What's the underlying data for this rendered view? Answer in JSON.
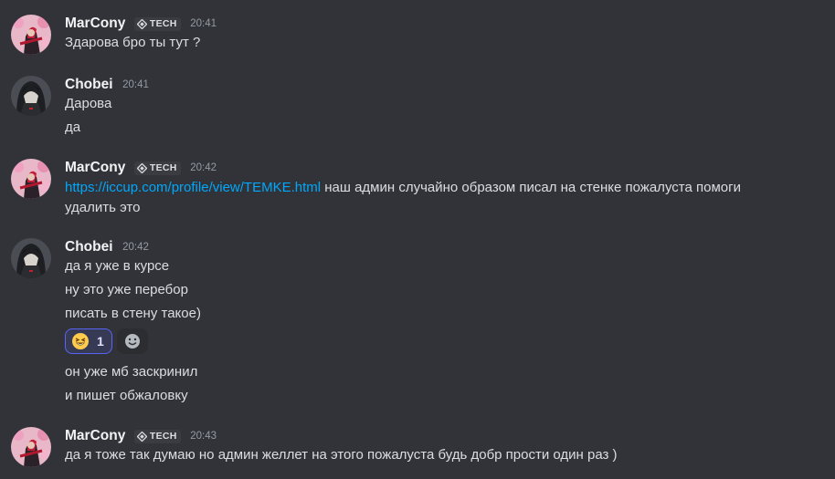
{
  "tag_label": "TECH",
  "messages": [
    {
      "author": "MarCony",
      "time": "20:41",
      "lines": [
        "Здарова бро ты тут ?"
      ]
    },
    {
      "author": "Chobei",
      "time": "20:41",
      "lines": [
        "Дарова",
        "да"
      ]
    },
    {
      "author": "MarCony",
      "time": "20:42",
      "link": "https://iccup.com/profile/view/TEMKE.html",
      "link_rest": " наш админ случайно образом писал на стенке пожалуста помоги",
      "lines": [
        "удалить это"
      ]
    },
    {
      "author": "Chobei",
      "time": "20:42",
      "lines": [
        "да я уже в курсе",
        "ну это уже перебор",
        "писать в стену такое)"
      ],
      "reaction": {
        "emoji": "laughing-face",
        "count": "1"
      },
      "lines_after": [
        "он уже мб заскринил",
        "и пишет обжаловку"
      ]
    },
    {
      "author": "MarCony",
      "time": "20:43",
      "lines": [
        "да я тоже так думаю но админ желлет на этого пожалуста будь добр прости один раз )"
      ]
    }
  ],
  "colors": {
    "background": "#313338",
    "username": "#f2f3f5",
    "timestamp": "#949ba4",
    "link": "#00a8fc",
    "reaction_border": "#5865f2"
  }
}
